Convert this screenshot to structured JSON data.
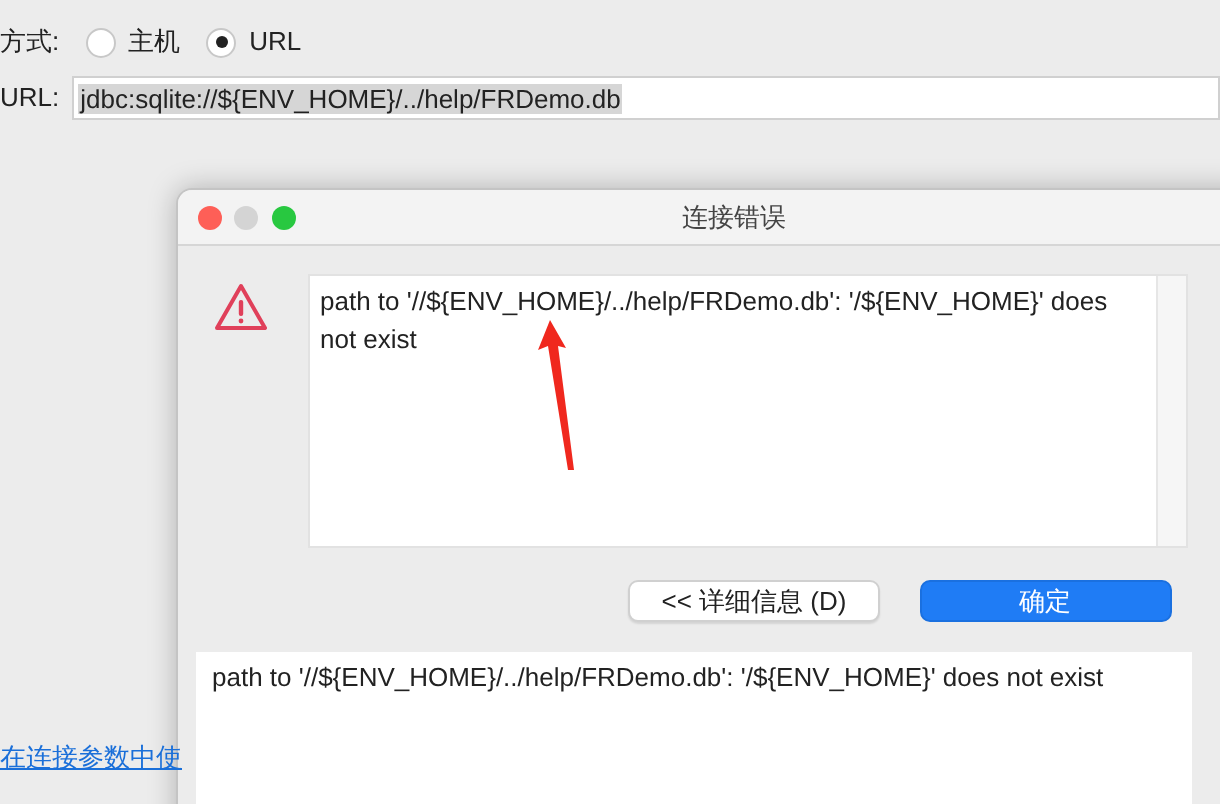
{
  "form": {
    "method_label": "方式:",
    "methods": [
      {
        "label": "主机",
        "selected": false
      },
      {
        "label": "URL",
        "selected": true
      }
    ],
    "url_label": "URL:",
    "url_value": "jdbc:sqlite://${ENV_HOME}/../help/FRDemo.db",
    "url_selected": true,
    "link": "在连接参数中使"
  },
  "dialog": {
    "title": "连接错误",
    "message": "path to '//${ENV_HOME}/../help/FRDemo.db': '/${ENV_HOME}' does not exist",
    "buttons": [
      {
        "label": "<< 详细信息 (D)",
        "kind": "default"
      },
      {
        "label": "确定",
        "kind": "primary"
      }
    ],
    "details": "path to '//${ENV_HOME}/../help/FRDemo.db': '/${ENV_HOME}' does not exist"
  }
}
